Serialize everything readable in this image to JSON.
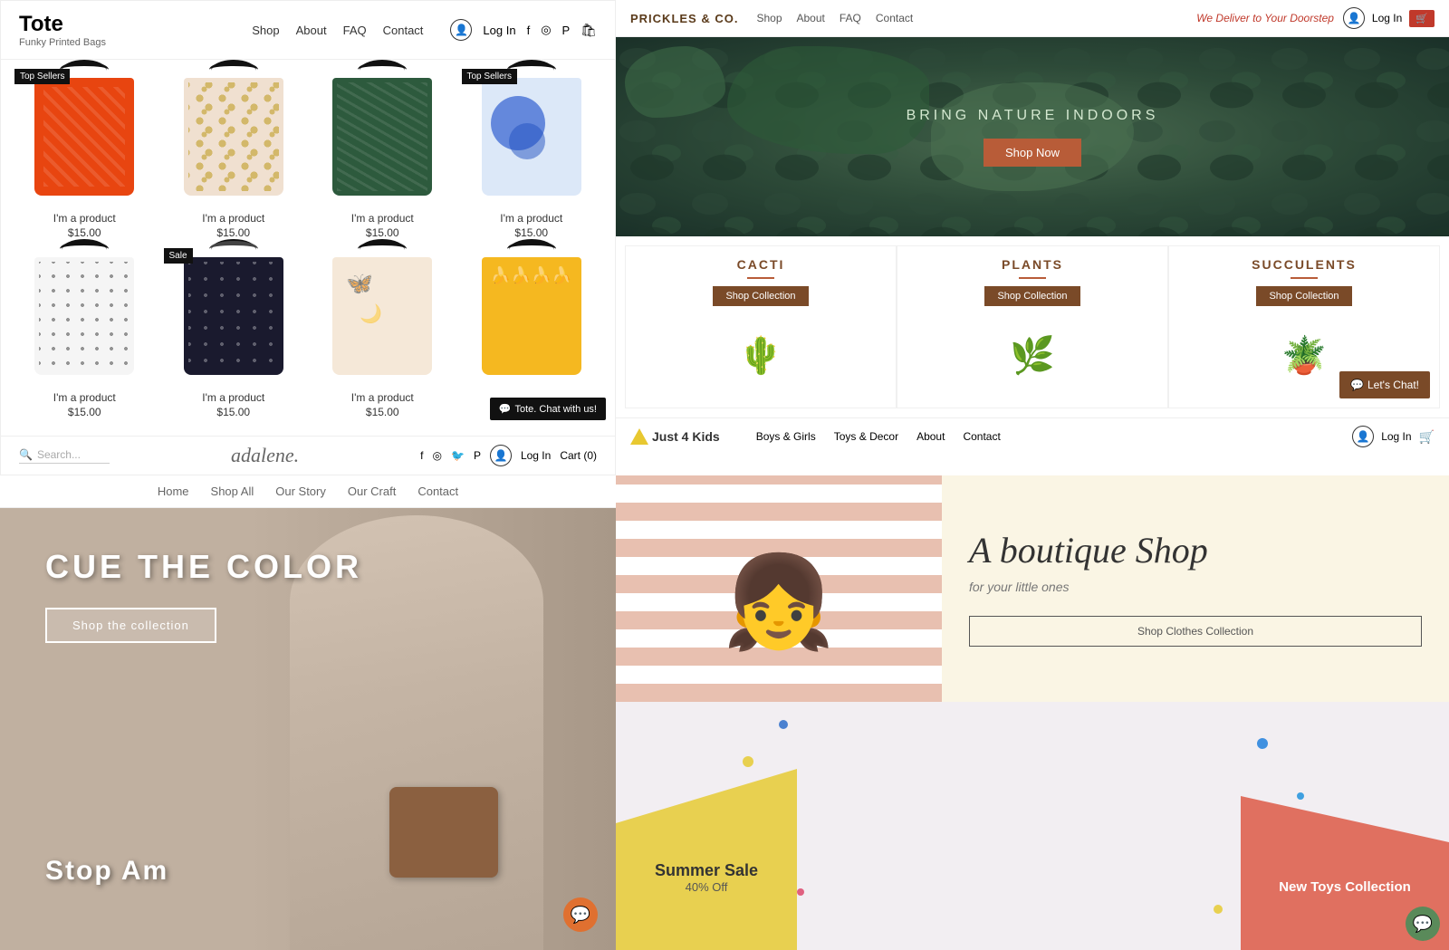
{
  "q1": {
    "brand": {
      "name": "Tote",
      "tagline": "Funky Printed Bags"
    },
    "nav": {
      "links": [
        "Shop",
        "About",
        "FAQ",
        "Contact"
      ],
      "login": "Log In"
    },
    "products": [
      {
        "name": "I'm a product",
        "price": "$15.00",
        "badge": "Top Sellers",
        "bag": "orange"
      },
      {
        "name": "I'm a product",
        "price": "$15.00",
        "badge": null,
        "bag": "spotted"
      },
      {
        "name": "I'm a product",
        "price": "$15.00",
        "badge": null,
        "bag": "green"
      },
      {
        "name": "I'm a product",
        "price": "$15.00",
        "badge": "Top Sellers",
        "bag": "blue"
      },
      {
        "name": "I'm a product",
        "price": "$15.00",
        "badge": null,
        "bag": "dotted"
      },
      {
        "name": "I'm a product",
        "price": "$15.00",
        "badge": "Sale",
        "bag": "black"
      },
      {
        "name": "I'm a product",
        "price": "$15.00",
        "badge": null,
        "bag": "pastel"
      },
      {
        "name": "I'm a product",
        "price": "$15.00",
        "badge": null,
        "bag": "yellow"
      }
    ],
    "chat": "Tote. Chat with us!",
    "footer": {
      "search_placeholder": "Search...",
      "brand_cursive": "adalene.",
      "login": "Log In",
      "cart": "Cart (0)"
    }
  },
  "q2": {
    "brand": "PRICKLES & CO.",
    "nav": {
      "links": [
        "Shop",
        "About",
        "FAQ",
        "Contact"
      ]
    },
    "deliver": "We Deliver to Your Doorstep",
    "login": "Log In",
    "hero": {
      "title": "BRING NATURE INDOORS",
      "cta": "Shop Now"
    },
    "categories": [
      {
        "name": "CACTI",
        "cta": "Shop Collection",
        "emoji": "🌵"
      },
      {
        "name": "PLANTS",
        "cta": "Shop Collection",
        "emoji": "🌿"
      },
      {
        "name": "SUCCULENTS",
        "cta": "Shop Collection",
        "emoji": "🪴"
      }
    ],
    "chat": "Let's Chat!",
    "subnav": {
      "brand": "Just 4 Kids",
      "links": [
        "Boys & Girls",
        "Toys & Decor",
        "About",
        "Contact"
      ],
      "login": "Log In"
    }
  },
  "q3": {
    "nav": {
      "links": [
        "Home",
        "Shop All",
        "Our Story",
        "Our Craft",
        "Contact"
      ]
    },
    "hero": {
      "title": "CUE THE COLOR",
      "cta": "Shop the collection",
      "stop_am": "Stop Am"
    }
  },
  "q4": {
    "hero": {
      "title": "A boutique Shop",
      "subtitle": "for your little ones",
      "cta": "Shop Clothes Collection"
    },
    "bottom": {
      "summer_title": "Summer Sale",
      "summer_sub": "40% Off",
      "new_toys_title": "New Toys Collection"
    },
    "chat": "Let's Chat!"
  }
}
